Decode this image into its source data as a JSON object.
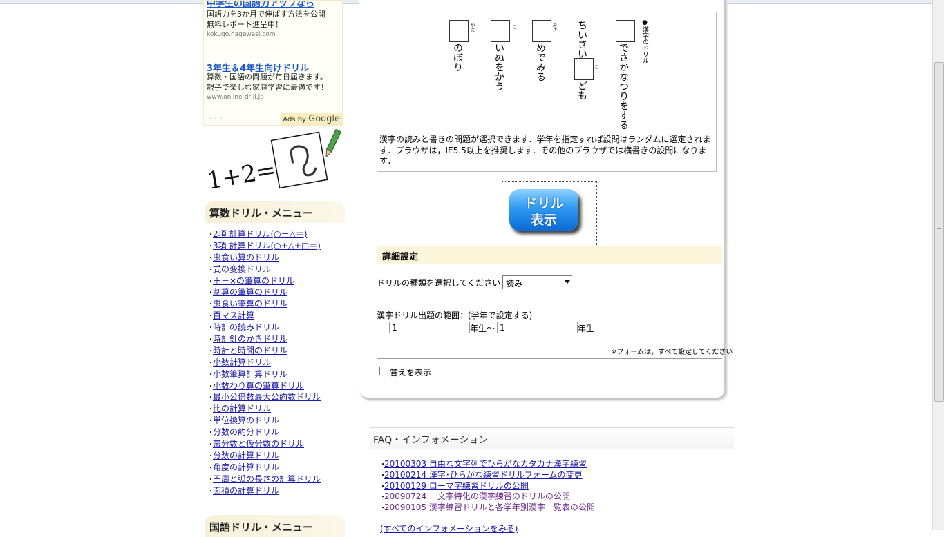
{
  "ads": {
    "ad1_title": "中学生の国語力アップなら",
    "ad1_line1": "国語力を3か月で伸ばす方法を公開",
    "ad1_line2": "無料レポート進呈中！",
    "ad1_url": "kokugo.hagewasi.com",
    "ad2_title": "3年生＆4年生向けドリル",
    "ad2_line1": "算数・国語の問題が毎日届きます。",
    "ad2_line2": "親子で楽しむ家庭学習に最適です！",
    "ad2_url": "www.online-drill.jp",
    "ads_by": "Ads by",
    "google": "Google"
  },
  "logo": {
    "equation": "1+2="
  },
  "math_menu": {
    "title": "算数ドリル・メニュー",
    "items": [
      "2項 計算ドリル(○＋△＝)",
      "3項 計算ドリル(○+△+□＝)",
      "虫食い算のドリル",
      "式の変換ドリル",
      "＋－×の筆算のドリル",
      "割算の筆算のドリル",
      "虫食い筆算のドリル",
      "百マス計算",
      "時計の読みドリル",
      "時計針のかきドリル",
      "時計と時間のドリル",
      "小数計算ドリル",
      "小数筆算計算ドリル",
      "小数わり算の筆算ドリル",
      "最小公倍数最大公約数ドリル",
      "比の計算ドリル",
      "単位換算のドリル",
      "分数の約分ドリル",
      "帯分数と仮分数のドリル",
      "分数の計算ドリル",
      "角度の計算ドリル",
      "円周と弧の長さの計算ドリル",
      "面積の計算ドリル"
    ]
  },
  "kokugo_menu": {
    "title": "国語ドリル・メニュー"
  },
  "sample": {
    "header": "●漢字のドリル",
    "q1_ruby": "かわ",
    "q1_text": "でさかなつりをする",
    "q2_pre": "ちいさい",
    "q2_ruby": "こ",
    "q2_post": "ども",
    "q3_ruby": "みぎ",
    "q3_text": "めでみる",
    "q4_ruby": "こ",
    "q4_text": "いぬをかう",
    "q5_ruby": "やま",
    "q5_text": "のぼり"
  },
  "description": "漢字の読みと書きの問題が選択できます．学年を指定すれば設問はランダムに選定されます．ブラウザは，IE5.5以上を推奨します．その他のブラウザでは横書きの設問になります．",
  "drill_button": {
    "line1": "ドリル",
    "line2": "表示"
  },
  "settings": {
    "title": "詳細設定",
    "type_label": "ドリルの種類を選択してください：",
    "type_value": "読み",
    "range_label": "漢字ドリル出題の範囲：(学年で設定する)",
    "from_value": "1",
    "from_suffix": "年生～",
    "to_value": "1",
    "to_suffix": "年生",
    "note": "※フォームは，すべて設定してください",
    "show_answer": "答えを表示"
  },
  "faq": {
    "title": "FAQ・インフォメーション",
    "items": [
      "20100303 自由な文字列でひらがなカタカナ漢字練習",
      "20100214 漢字･ひらがな練習ドリルフォームの変更",
      "20100129 ローマ字練習ドリルの公開",
      "20090724 一文字特化の漢字練習のドリルの公開",
      "20090105 漢字練習ドリルと各学年別漢字一覧表の公開"
    ],
    "all_link": "(すべてのインフォメーションをみる)"
  }
}
